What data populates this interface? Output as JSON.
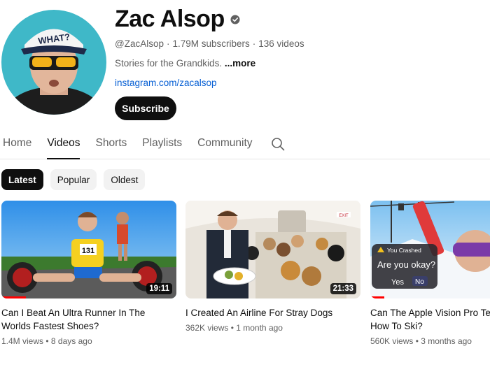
{
  "channel": {
    "name": "Zac Alsop",
    "handle": "@ZacAlsop",
    "subscribers": "1.79M subscribers",
    "videos_count": "136 videos",
    "separator": "·",
    "description": "Stories for the Grandkids.",
    "more_label": "...more",
    "link": "instagram.com/zacalsop",
    "subscribe_label": "Subscribe",
    "avatar_hat_text": "WHAT?"
  },
  "tabs": [
    {
      "label": "Home",
      "active": false
    },
    {
      "label": "Videos",
      "active": true
    },
    {
      "label": "Shorts",
      "active": false
    },
    {
      "label": "Playlists",
      "active": false
    },
    {
      "label": "Community",
      "active": false
    }
  ],
  "chips": [
    {
      "label": "Latest",
      "active": true
    },
    {
      "label": "Popular",
      "active": false
    },
    {
      "label": "Oldest",
      "active": false
    }
  ],
  "videos": [
    {
      "title": "Can I Beat An Ultra Runner In The\nWorlds Fastest Shoes?",
      "views": "1.4M views",
      "age": "8 days ago",
      "duration": "19:11",
      "watched_fraction": 0.14,
      "bib_number": "131"
    },
    {
      "title": "I Created An Airline For Stray Dogs",
      "views": "362K views",
      "age": "1 month ago",
      "duration": "21:33",
      "exit_sign": "EXIT"
    },
    {
      "title": "Can The Apple Vision Pro Tea\nHow To Ski?",
      "views": "560K views",
      "age": "3 months ago",
      "watched_fraction": 0.08,
      "overlay_alert": "You Crashed",
      "overlay_question": "Are you okay?",
      "overlay_yes": "Yes",
      "overlay_no": "No"
    }
  ],
  "colors": {
    "subscribe_bg": "#0f0f0f",
    "link": "#065fd4",
    "progress": "#ff0000",
    "chip_bg": "#f2f2f2"
  }
}
